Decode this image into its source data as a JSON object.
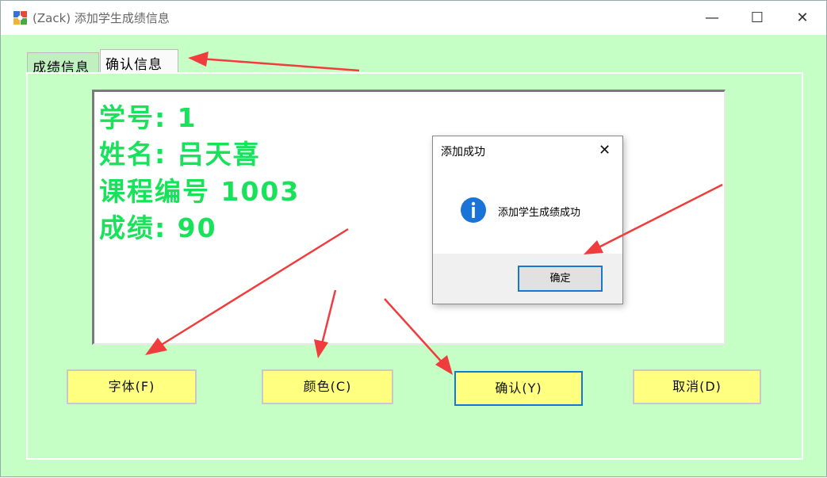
{
  "window": {
    "title": "(Zack)  添加学生成绩信息",
    "minimize_glyph": "—",
    "maximize_glyph": "☐",
    "close_glyph": "✕",
    "icon": "app-icon"
  },
  "tabs": [
    {
      "label": "成绩信息",
      "selected": false
    },
    {
      "label": "确认信息",
      "selected": true
    }
  ],
  "display": {
    "lines": [
      "学号: 1",
      "姓名: 吕天喜",
      "课程编号 1003",
      "成绩: 90"
    ],
    "text_color": "#18e25a"
  },
  "buttons": {
    "font": "字体(F)",
    "color": "颜色(C)",
    "confirm": "确认(Y)",
    "cancel": "取消(D)"
  },
  "dialog": {
    "title": "添加成功",
    "close_glyph": "✕",
    "icon": "info-icon",
    "message": "添加学生成绩成功",
    "ok_label": "确定"
  },
  "colors": {
    "background": "#c6ffc6",
    "button_fill": "#ffff80",
    "focus_border": "#1478d4",
    "annotation_arrow": "#f03c3c"
  }
}
